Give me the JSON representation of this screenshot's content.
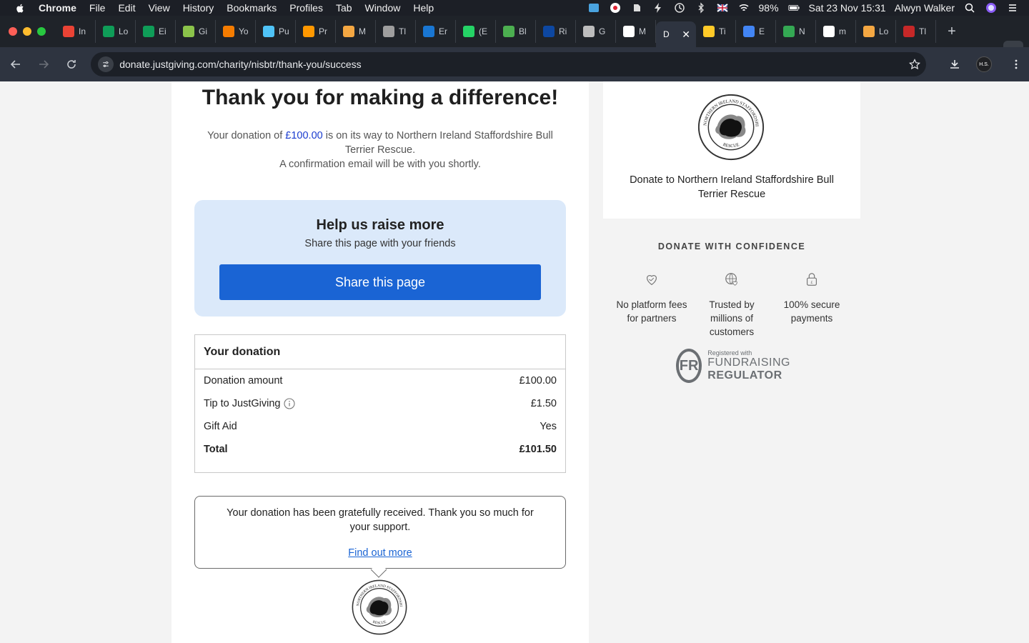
{
  "menubar": {
    "app_name": "Chrome",
    "items": [
      "File",
      "Edit",
      "View",
      "History",
      "Bookmarks",
      "Profiles",
      "Tab",
      "Window",
      "Help"
    ],
    "battery": "98%",
    "datetime": "Sat 23 Nov  15:31",
    "user": "Alwyn Walker"
  },
  "tabs": [
    {
      "label": "In",
      "color": "#ea4335"
    },
    {
      "label": "Lo",
      "color": "#0f9d58"
    },
    {
      "label": "Ei",
      "color": "#0f9d58"
    },
    {
      "label": "Gi",
      "color": "#8bc34a"
    },
    {
      "label": "Yo",
      "color": "#f57c00"
    },
    {
      "label": "Pu",
      "color": "#4fc3f7"
    },
    {
      "label": "Pr",
      "color": "#ff9800"
    },
    {
      "label": "M",
      "color": "#f4a742"
    },
    {
      "label": "Tl",
      "color": "#9e9e9e"
    },
    {
      "label": "Er",
      "color": "#1976d2"
    },
    {
      "label": "(E",
      "color": "#25d366"
    },
    {
      "label": "Bl",
      "color": "#4caf50"
    },
    {
      "label": "Ri",
      "color": "#0d47a1"
    },
    {
      "label": "G",
      "color": "#bdbdbd"
    },
    {
      "label": "M",
      "color": "#ffffff"
    },
    {
      "label": "D",
      "active": true,
      "color": "#2e3440"
    },
    {
      "label": "Ti",
      "color": "#ffca28"
    },
    {
      "label": "E",
      "color": "#4285f4"
    },
    {
      "label": "N",
      "color": "#34a853"
    },
    {
      "label": "m",
      "color": "#ffffff"
    },
    {
      "label": "Lo",
      "color": "#f4a742"
    },
    {
      "label": "Tl",
      "color": "#c62828"
    }
  ],
  "address_bar": {
    "url": "donate.justgiving.com/charity/nisbtr/thank-you/success",
    "profile_initials": "H.S."
  },
  "main": {
    "heading": "Thank you for making a difference!",
    "intro_prefix": "Your donation of ",
    "intro_amount": "£100.00",
    "intro_suffix": " is on its way to Northern Ireland Staffordshire Bull Terrier Rescue.",
    "intro_line2": "A confirmation email will be with you shortly.",
    "share": {
      "title": "Help us raise more",
      "subtitle": "Share this page with your friends",
      "button": "Share this page"
    },
    "donation": {
      "title": "Your donation",
      "rows": [
        {
          "label": "Donation amount",
          "value": "£100.00"
        },
        {
          "label": "Tip to JustGiving",
          "value": "£1.50"
        },
        {
          "label": "Gift Aid",
          "value": "Yes"
        },
        {
          "label": "Total",
          "value": "£101.50"
        }
      ]
    },
    "message": {
      "text": "Your donation has been gratefully received. Thank you so much for your support.",
      "link": "Find out more"
    }
  },
  "sidebar": {
    "charity_text": "Donate to Northern Ireland Staffordshire Bull Terrier Rescue",
    "confidence_title": "DONATE WITH CONFIDENCE",
    "features": [
      {
        "icon": "heart-hand-icon",
        "text": "No platform fees for partners"
      },
      {
        "icon": "globe-heart-icon",
        "text": "Trusted by millions of customers"
      },
      {
        "icon": "padlock-icon",
        "text": "100% secure payments"
      }
    ],
    "regulator": {
      "badge": "FR",
      "small": "Registered with",
      "line1": "FUNDRAISING",
      "line2": "REGULATOR"
    }
  },
  "logo": {
    "top_text": "NORTHERN IRELAND STAFFORDSHIRE BULL TERRIER",
    "bottom_text": "RESCUE"
  }
}
